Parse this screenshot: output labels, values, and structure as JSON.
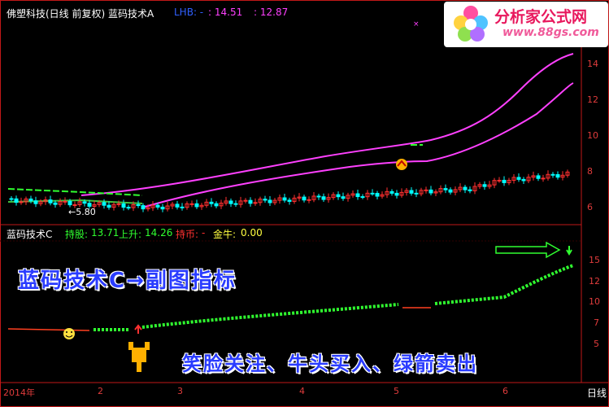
{
  "header": {
    "title": "佛塑科技(日线 前复权) 蓝码技术A",
    "lhb_label": "LHB: -",
    "value_a": ": 14.51",
    "value_b": ": 12.87"
  },
  "logo": {
    "name": "分析家公式网",
    "url": "www.88gs.com"
  },
  "main": {
    "y_ticks": [
      "14",
      "12",
      "10",
      "8",
      "6"
    ],
    "low_label": "←5.80"
  },
  "sub": {
    "name": "蓝码技术C",
    "hold_label": "持股:",
    "hold_value": "13.71",
    "rise_label": "上升:",
    "rise_value": "14.26",
    "coin_label": "持币:",
    "coin_value": "-",
    "gold_label": "金牛:",
    "gold_value": "0.00",
    "y_ticks": [
      "15",
      "12",
      "10",
      "7",
      "5"
    ]
  },
  "overlay": {
    "title": "蓝码技术C→副图指标",
    "note": "笑脸关注、牛头买入、绿箭卖出"
  },
  "x_axis": {
    "ticks": [
      "2014年",
      "2",
      "3",
      "4",
      "5",
      "6"
    ],
    "period_label": "日线"
  },
  "colors": {
    "candle_up": "#ff3030",
    "candle_down": "#00ffff",
    "ma_short": "#ff40ff",
    "green_signal": "#30ff30",
    "axis": "#c01818"
  }
}
